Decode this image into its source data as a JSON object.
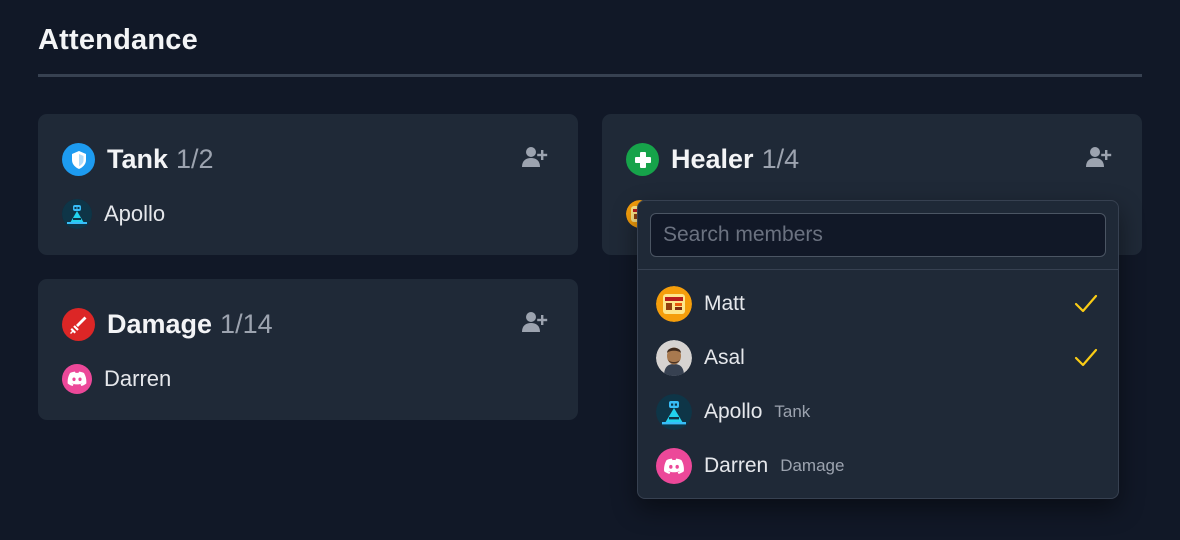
{
  "page": {
    "title": "Attendance"
  },
  "roles": [
    {
      "key": "tank",
      "name": "Tank",
      "count": "1/2",
      "color": "#1d9bf0",
      "icon": "shield-icon",
      "members": [
        {
          "name": "Apollo",
          "avatar": "robot-avatar"
        }
      ]
    },
    {
      "key": "healer",
      "name": "Healer",
      "count": "1/4",
      "color": "#16a34a",
      "icon": "medical-cross-icon",
      "members": [
        {
          "name": "Matt",
          "avatar": "pixel-art-avatar"
        }
      ]
    },
    {
      "key": "damage",
      "name": "Damage",
      "count": "1/14",
      "color": "#dc2626",
      "icon": "sword-icon",
      "members": [
        {
          "name": "Darren",
          "avatar": "discord-avatar"
        }
      ]
    }
  ],
  "add_member_icon": "user-plus-icon",
  "dropdown": {
    "search_placeholder": "Search members",
    "search_value": "",
    "items": [
      {
        "name": "Matt",
        "tag": "",
        "checked": true,
        "avatar": "pixel-art-avatar"
      },
      {
        "name": "Asal",
        "tag": "",
        "checked": true,
        "avatar": "photo-avatar"
      },
      {
        "name": "Apollo",
        "tag": "Tank",
        "checked": false,
        "avatar": "robot-avatar"
      },
      {
        "name": "Darren",
        "tag": "Damage",
        "checked": false,
        "avatar": "discord-avatar"
      }
    ],
    "check_color": "#facc15"
  }
}
